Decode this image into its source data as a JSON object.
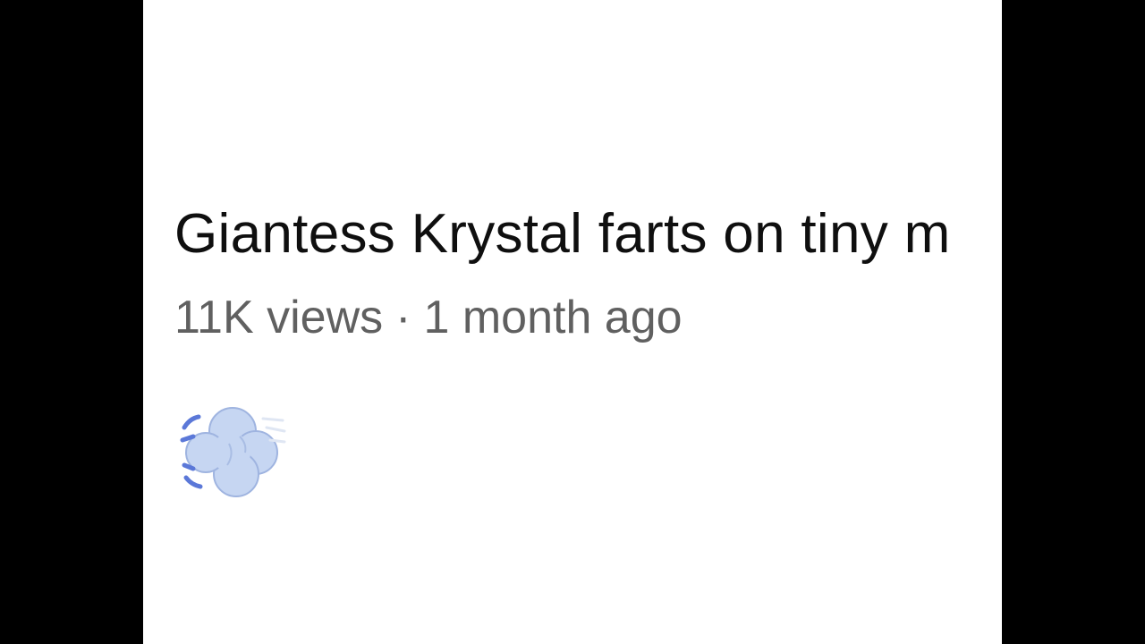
{
  "video": {
    "title": "Giantess Krystal farts on tiny m",
    "views": "11K views",
    "separator": "·",
    "age": "1 month ago"
  },
  "emoji": {
    "icon": "dashing-away-icon",
    "fill_color": "#c6d6f2",
    "accent_color": "#5b78d8"
  },
  "colors": {
    "letterbox": "#000000",
    "background": "#ffffff",
    "title_text": "#0f0f0f",
    "meta_text": "#606060"
  }
}
